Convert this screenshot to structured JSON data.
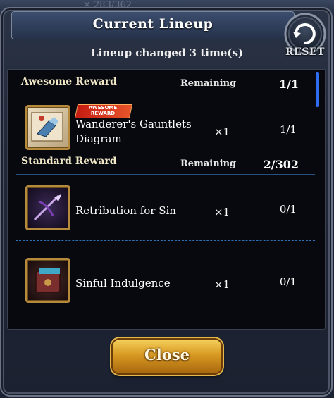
{
  "backdrop_text": "✕ 283/362",
  "title": "Current Lineup",
  "reset_label": "RESET",
  "subtitle": "Lineup changed 3 time(s)",
  "awesome": {
    "title": "Awesome Reward",
    "remaining_label": "Remaining",
    "remaining": "1/1",
    "items": [
      {
        "name_line1": "Wanderer's Gauntlets",
        "name_line2": "Diagram",
        "badge_line1": "AWESOME",
        "badge_line2": "REWARD",
        "qty": "×1",
        "count": "1/1",
        "icon": "scroll-diagram-icon"
      }
    ]
  },
  "standard": {
    "title": "Standard Reward",
    "remaining_label": "Remaining",
    "remaining": "2/302",
    "items": [
      {
        "name": "Retribution for Sin",
        "qty": "×1",
        "count": "0/1",
        "icon": "crossbow-icon"
      },
      {
        "name": "Sinful Indulgence",
        "qty": "×1",
        "count": "0/1",
        "icon": "book-icon"
      }
    ]
  },
  "close_label": "Close",
  "colors": {
    "accent_gold": "#d89a22",
    "divider_blue": "#2c6fb4",
    "scroll_blue": "#2f6df0"
  }
}
